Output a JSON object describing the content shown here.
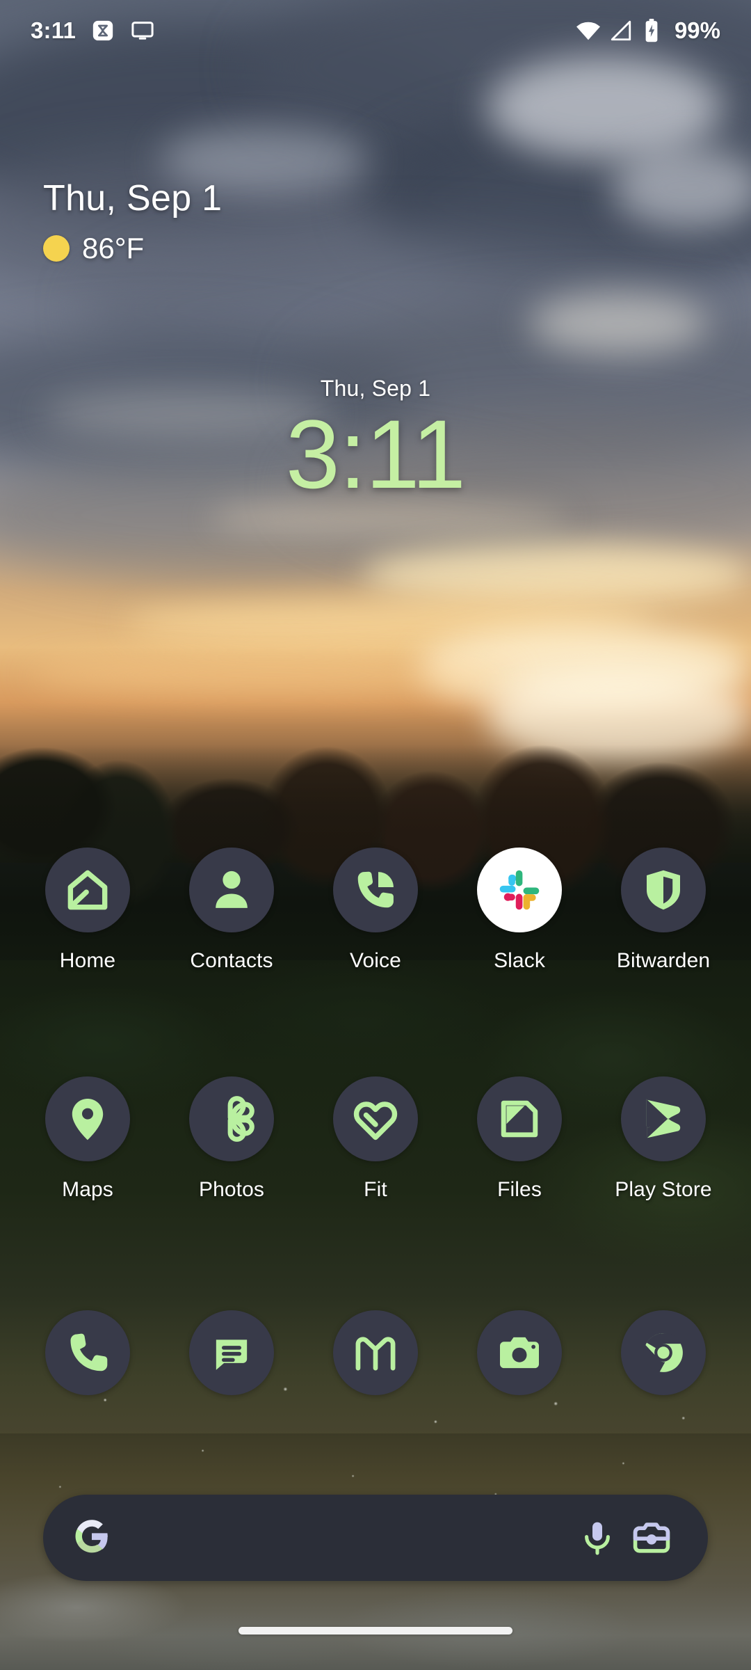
{
  "status_bar": {
    "time": "3:11",
    "battery_percent": "99%",
    "notification_icons": [
      "sigma-app-icon",
      "cast-screen-icon"
    ],
    "system_icons": [
      "wifi-icon",
      "cellular-signal-icon",
      "battery-charging-icon"
    ]
  },
  "date_widget": {
    "date": "Thu, Sep 1",
    "temperature": "86°F",
    "condition_icon": "sunny-icon"
  },
  "clock_widget": {
    "date": "Thu, Sep 1",
    "time": "3:11"
  },
  "app_rows": [
    [
      {
        "label": "Home",
        "icon": "home-icon"
      },
      {
        "label": "Contacts",
        "icon": "contacts-person-icon"
      },
      {
        "label": "Voice",
        "icon": "google-voice-icon"
      },
      {
        "label": "Slack",
        "icon": "slack-icon"
      },
      {
        "label": "Bitwarden",
        "icon": "bitwarden-shield-icon"
      }
    ],
    [
      {
        "label": "Maps",
        "icon": "map-pin-icon"
      },
      {
        "label": "Photos",
        "icon": "google-photos-pinwheel-icon"
      },
      {
        "label": "Fit",
        "icon": "google-fit-heart-icon"
      },
      {
        "label": "Files",
        "icon": "files-document-icon"
      },
      {
        "label": "Play Store",
        "icon": "play-store-triangle-icon"
      }
    ]
  ],
  "dock": [
    {
      "label": "Phone",
      "icon": "phone-handset-icon"
    },
    {
      "label": "Messages",
      "icon": "messages-bubble-icon"
    },
    {
      "label": "Gmail",
      "icon": "gmail-m-icon"
    },
    {
      "label": "Camera",
      "icon": "camera-icon"
    },
    {
      "label": "Chrome",
      "icon": "chrome-icon"
    }
  ],
  "search_bar": {
    "leading_icon": "google-g-icon",
    "placeholder": "",
    "value": "",
    "actions": [
      "microphone-icon",
      "google-lens-camera-icon"
    ]
  },
  "navigation": {
    "gesture_pill": "home-gesture-pill"
  },
  "colors": {
    "icon_bg": "#383a49",
    "icon_glyph": "#b9f0a0",
    "clock_green": "#c5efa3",
    "search_bg": "#2b2e38",
    "sun_yellow": "#f5d34f",
    "text_white": "#ffffff",
    "lens_lavender": "#c6c8ee"
  }
}
